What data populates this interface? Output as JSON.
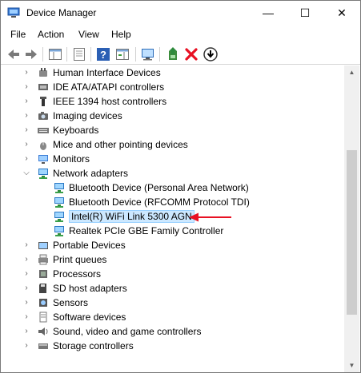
{
  "window": {
    "title": "Device Manager",
    "minimize_glyph": "—",
    "maximize_glyph": "☐",
    "close_glyph": "✕"
  },
  "menu": [
    "File",
    "Action",
    "View",
    "Help"
  ],
  "toolbar": {
    "buttons": [
      "back-icon",
      "forward-icon",
      "show-hide-console-tree-icon",
      "properties-icon",
      "help-icon",
      "action-pane-icon",
      "scan-hardware-icon",
      "update-driver-icon",
      "uninstall-icon",
      "disable-device-icon"
    ]
  },
  "tree": {
    "items": [
      {
        "label": "Human Interface Devices",
        "expanded": false,
        "icon": "hid-icon"
      },
      {
        "label": "IDE ATA/ATAPI controllers",
        "expanded": false,
        "icon": "ide-controller-icon"
      },
      {
        "label": "IEEE 1394 host controllers",
        "expanded": false,
        "icon": "ieee1394-icon"
      },
      {
        "label": "Imaging devices",
        "expanded": false,
        "icon": "camera-icon"
      },
      {
        "label": "Keyboards",
        "expanded": false,
        "icon": "keyboard-icon"
      },
      {
        "label": "Mice and other pointing devices",
        "expanded": false,
        "icon": "mouse-icon"
      },
      {
        "label": "Monitors",
        "expanded": false,
        "icon": "monitor-icon"
      },
      {
        "label": "Network adapters",
        "expanded": true,
        "icon": "network-adapter-icon"
      },
      {
        "label": "Bluetooth Device (Personal Area Network)",
        "child": true,
        "icon": "network-adapter-icon"
      },
      {
        "label": "Bluetooth Device (RFCOMM Protocol TDI)",
        "child": true,
        "icon": "network-adapter-icon"
      },
      {
        "label": "Intel(R) WiFi Link 5300 AGN",
        "child": true,
        "selected": true,
        "icon": "network-adapter-icon"
      },
      {
        "label": "Realtek PCIe GBE Family Controller",
        "child": true,
        "icon": "network-adapter-icon"
      },
      {
        "label": "Portable Devices",
        "expanded": false,
        "icon": "portable-device-icon"
      },
      {
        "label": "Print queues",
        "expanded": false,
        "icon": "printer-icon"
      },
      {
        "label": "Processors",
        "expanded": false,
        "icon": "processor-icon"
      },
      {
        "label": "SD host adapters",
        "expanded": false,
        "icon": "sd-card-icon"
      },
      {
        "label": "Sensors",
        "expanded": false,
        "icon": "sensor-icon"
      },
      {
        "label": "Software devices",
        "expanded": false,
        "icon": "software-device-icon"
      },
      {
        "label": "Sound, video and game controllers",
        "expanded": false,
        "icon": "speaker-icon"
      },
      {
        "label": "Storage controllers",
        "expanded": false,
        "icon": "storage-controller-icon"
      }
    ]
  },
  "annotation": {
    "color": "#e81123",
    "icon": "red-arrow-icon"
  },
  "colors": {
    "selection": "#cce8ff",
    "selection_border": "#99d1ff",
    "uninstall": "#e81123",
    "scan": "#2e8b3d"
  }
}
